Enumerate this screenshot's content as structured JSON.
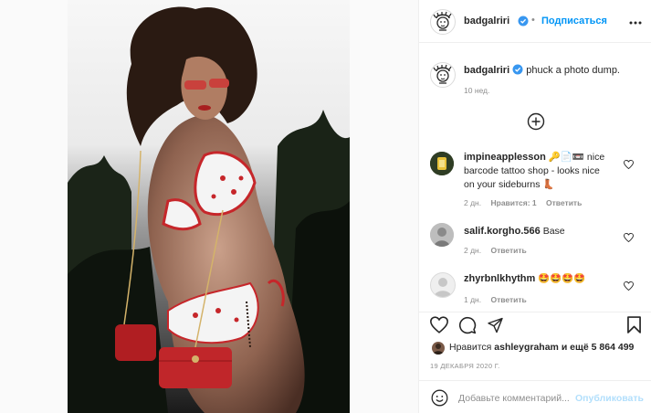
{
  "post": {
    "author": "badgalriri",
    "follow_label": "Подписаться",
    "caption_user": "badgalriri",
    "caption_text": "phuck a photo dump.",
    "caption_age": "10 нед."
  },
  "comments": [
    {
      "user": "impineapplesson",
      "text_line1": "🔑📄📼 nice",
      "text_line2": "barcode tattoo shop - looks nice",
      "text_line3": "on your sideburns 👢",
      "age": "2 дн.",
      "likes": "Нравится: 1",
      "reply": "Ответить"
    },
    {
      "user": "salif.korgho.566",
      "text": "Base",
      "age": "2 дн.",
      "reply": "Ответить"
    },
    {
      "user": "zhyrbnlkhythm",
      "text": "🤩🤩🤩🤩",
      "age": "1 дн.",
      "reply": "Ответить"
    }
  ],
  "likes": {
    "prefix": "Нравится",
    "user": "ashleygraham",
    "mid": "и ещё",
    "count": "5 864 499"
  },
  "date": "19 ДЕКАБРЯ 2020 Г.",
  "composer": {
    "placeholder": "Добавьте комментарий...",
    "publish": "Опубликовать"
  },
  "colors": {
    "accent": "#0095f6",
    "verified": "#3897f0",
    "text": "#262626",
    "muted": "#8e8e8e",
    "publish_disabled": "#b2dffc"
  },
  "icons": [
    "more-icon",
    "verified-icon",
    "load-more-icon",
    "heart-icon",
    "comment-icon",
    "share-icon",
    "bookmark-icon",
    "emoji-icon"
  ]
}
